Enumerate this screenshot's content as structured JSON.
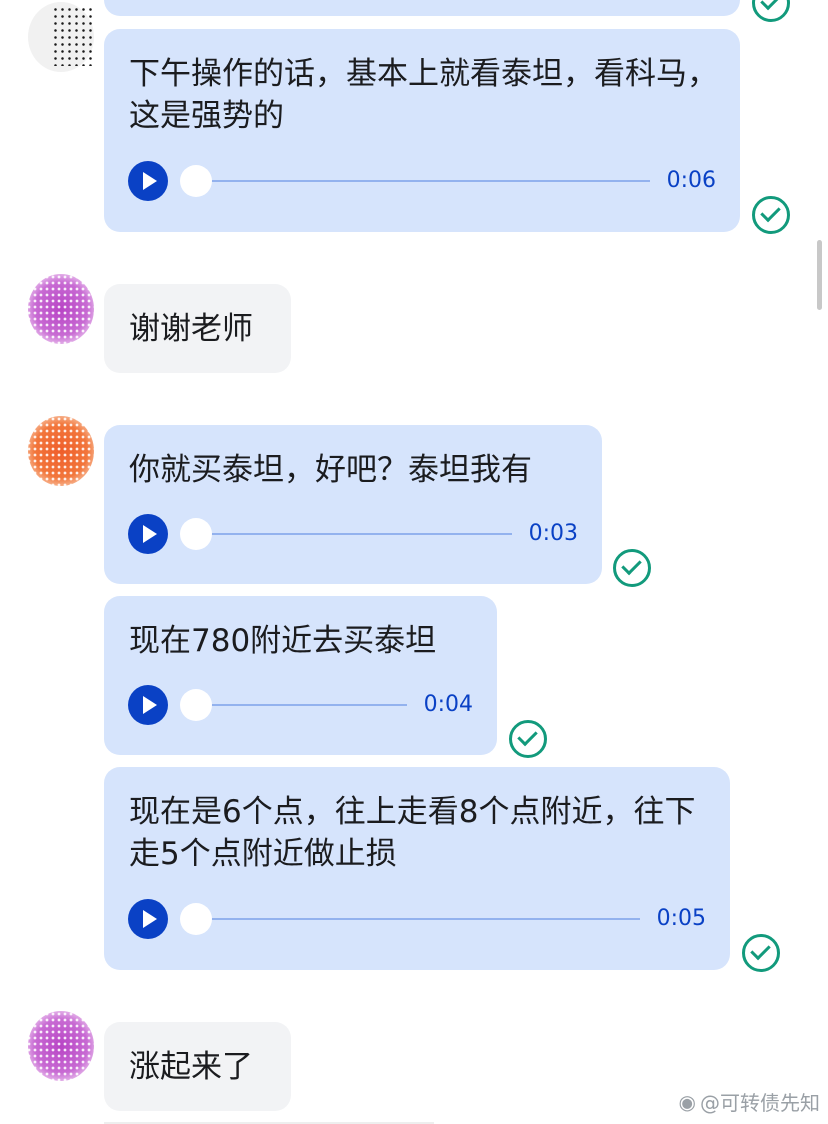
{
  "messages": [
    {
      "text": "下午操作的话，基本上就看泰坦，看科马，这是强势的",
      "duration": "0:06"
    },
    {
      "text": "谢谢老师"
    },
    {
      "text": "你就买泰坦，好吧？泰坦我有",
      "duration": "0:03"
    },
    {
      "text": "现在780附近去买泰坦",
      "duration": "0:04"
    },
    {
      "text": "现在是6个点，往上走看8个点附近，往下走5个点附近做止损",
      "duration": "0:05"
    },
    {
      "text": "涨起来了"
    }
  ],
  "watermark": "@可转债先知",
  "colors": {
    "outgoing_bubble": "#d6e4fc",
    "incoming_bubble": "#f2f3f5",
    "play_button": "#0a41c5",
    "read_check": "#129a7c"
  },
  "icons": {
    "play": "play-icon",
    "read": "check-circle-icon",
    "weibo": "weibo-icon"
  }
}
